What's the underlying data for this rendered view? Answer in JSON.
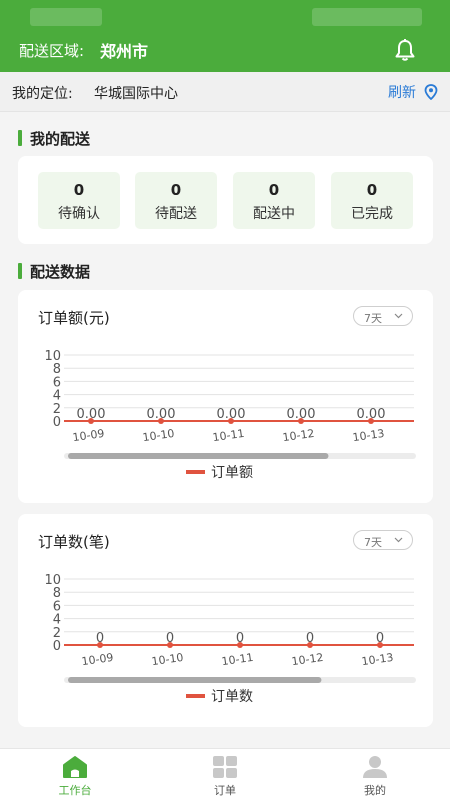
{
  "header": {
    "region_label": "配送区域:",
    "region_city": "郑州市"
  },
  "location": {
    "label": "我的定位:",
    "value": "华城国际中心",
    "refresh_label": "刷新"
  },
  "my_delivery": {
    "title": "我的配送",
    "stats": [
      {
        "value": "0",
        "label": "待确认"
      },
      {
        "value": "0",
        "label": "待配送"
      },
      {
        "value": "0",
        "label": "配送中"
      },
      {
        "value": "0",
        "label": "已完成"
      }
    ]
  },
  "delivery_data": {
    "title": "配送数据"
  },
  "charts": [
    {
      "title": "订单额(元)",
      "range_label": "7天"
    },
    {
      "title": "订单数(笔)",
      "range_label": "7天"
    }
  ],
  "chart_data": [
    {
      "type": "line",
      "categories": [
        "10-09",
        "10-10",
        "10-11",
        "10-12",
        "10-13"
      ],
      "series": [
        {
          "name": "订单额",
          "values": [
            0,
            0,
            0,
            0,
            0
          ]
        }
      ],
      "data_labels": [
        "0.00",
        "0.00",
        "0.00",
        "0.00",
        "0.00"
      ],
      "yticks": [
        "0",
        "2",
        "4",
        "6",
        "8",
        "10"
      ],
      "ylim": [
        0,
        10
      ],
      "grid": true,
      "legend": "bottom",
      "scroll_fraction": 0.74
    },
    {
      "type": "line",
      "categories": [
        "10-09",
        "10-10",
        "10-11",
        "10-12",
        "10-13"
      ],
      "series": [
        {
          "name": "订单数",
          "values": [
            0,
            0,
            0,
            0,
            0
          ]
        }
      ],
      "data_labels": [
        "0",
        "0",
        "0",
        "0",
        "0"
      ],
      "yticks": [
        "0",
        "2",
        "4",
        "6",
        "8",
        "10"
      ],
      "ylim": [
        0,
        10
      ],
      "grid": true,
      "legend": "bottom",
      "scroll_fraction": 0.72
    }
  ],
  "tabs": [
    {
      "label": "工作台",
      "active": true
    },
    {
      "label": "订单",
      "active": false
    },
    {
      "label": "我的",
      "active": false
    }
  ],
  "colors": {
    "brand": "#4bac3c",
    "series": "#e0533f",
    "link": "#2a7bd6"
  }
}
